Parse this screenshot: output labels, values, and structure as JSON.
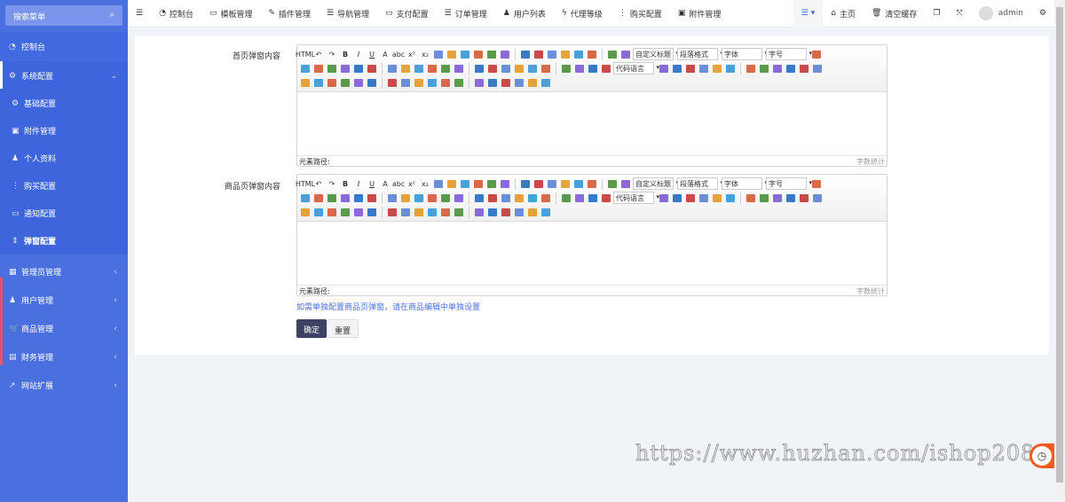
{
  "sidebar": {
    "search_placeholder": "搜索菜单",
    "items": [
      {
        "label": "控制台",
        "icon": "dashboard-icon",
        "glyph": "◔"
      },
      {
        "label": "系统配置",
        "icon": "cogs-icon",
        "glyph": "⚙"
      }
    ],
    "sub": [
      {
        "label": "基础配置",
        "icon": "gear-icon",
        "glyph": "⚙"
      },
      {
        "label": "附件管理",
        "icon": "image-icon",
        "glyph": "▣"
      },
      {
        "label": "个人资料",
        "icon": "user-icon",
        "glyph": "♟"
      },
      {
        "label": "购买配置",
        "icon": "ellipsis-icon",
        "glyph": "⋮"
      },
      {
        "label": "通知配置",
        "icon": "chat-icon",
        "glyph": "▭"
      },
      {
        "label": "弹窗配置",
        "icon": "sort-icon",
        "glyph": "⇕"
      }
    ],
    "groups": [
      {
        "label": "管理员管理",
        "icon": "windows-icon",
        "glyph": "▦"
      },
      {
        "label": "用户管理",
        "icon": "user-icon",
        "glyph": "♟"
      },
      {
        "label": "商品管理",
        "icon": "cart-icon",
        "glyph": "🛒"
      },
      {
        "label": "财务管理",
        "icon": "board-icon",
        "glyph": "▤"
      },
      {
        "label": "网站扩展",
        "icon": "external-link-icon",
        "glyph": "↗"
      }
    ]
  },
  "topnav": {
    "items": [
      {
        "label": "控制台",
        "icon": "dashboard-icon",
        "glyph": "◔"
      },
      {
        "label": "模板管理",
        "icon": "desktop-icon",
        "glyph": "▭"
      },
      {
        "label": "插件管理",
        "icon": "plug-icon",
        "glyph": "✎"
      },
      {
        "label": "导航管理",
        "icon": "sliders-icon",
        "glyph": "☰"
      },
      {
        "label": "支付配置",
        "icon": "credit-card-icon",
        "glyph": "▭"
      },
      {
        "label": "订单管理",
        "icon": "list-icon",
        "glyph": "☰"
      },
      {
        "label": "用户列表",
        "icon": "user-icon",
        "glyph": "♟"
      },
      {
        "label": "代理等级",
        "icon": "flash-icon",
        "glyph": "ϟ"
      },
      {
        "label": "购买配置",
        "icon": "ellipsis-icon",
        "glyph": "⋮"
      },
      {
        "label": "附件管理",
        "icon": "image-icon",
        "glyph": "▣"
      }
    ],
    "home": "主页",
    "clear_cache": "清空缓存",
    "user": "admin"
  },
  "form": {
    "field1_label": "首页弹窗内容",
    "field2_label": "商品页弹窗内容",
    "element_path": "元素路径:",
    "word_count": "字数统计",
    "help": "如需单独配置商品页弹窗，请在商品编辑中单独设置",
    "submit": "确定",
    "reset": "重置"
  },
  "editor_toolbar": {
    "selects": [
      "自定义标题",
      "段落格式",
      "字体",
      "字号"
    ],
    "code_lang": "代码语言"
  },
  "watermark": "https://www.huzhan.com/ishop2083",
  "colors": {
    "sidebar": "#4a70e0",
    "accent": "#3b4263",
    "link": "#4a70e0"
  }
}
